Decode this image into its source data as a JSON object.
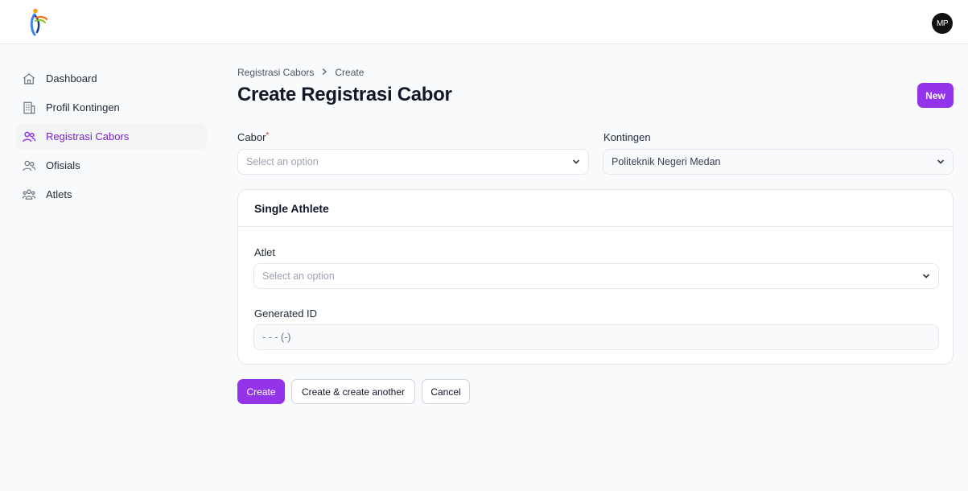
{
  "user": {
    "initials": "MP"
  },
  "sidebar": {
    "items": [
      {
        "label": "Dashboard",
        "icon": "home-icon",
        "active": false
      },
      {
        "label": "Profil Kontingen",
        "icon": "building-icon",
        "active": false
      },
      {
        "label": "Registrasi Cabors",
        "icon": "users-icon",
        "active": true
      },
      {
        "label": "Ofisials",
        "icon": "users-icon",
        "active": false
      },
      {
        "label": "Atlets",
        "icon": "user-group-icon",
        "active": false
      }
    ]
  },
  "breadcrumb": {
    "parent": "Registrasi Cabors",
    "separator": ">",
    "current": "Create"
  },
  "header": {
    "title": "Create Registrasi Cabor",
    "new_label": "New"
  },
  "form": {
    "cabor": {
      "label": "Cabor",
      "required_mark": "*",
      "placeholder": "Select an option"
    },
    "kontingen": {
      "label": "Kontingen",
      "value": "Politeknik Negeri Medan"
    },
    "single_athlete": {
      "title": "Single Athlete",
      "atlet": {
        "label": "Atlet",
        "placeholder": "Select an option"
      },
      "generated_id": {
        "label": "Generated ID",
        "value": "- - - (-)"
      }
    }
  },
  "actions": {
    "create": "Create",
    "create_another": "Create & create another",
    "cancel": "Cancel"
  },
  "colors": {
    "accent": "#9333ea",
    "active_text": "#7e22ce",
    "required": "#dc2626"
  }
}
